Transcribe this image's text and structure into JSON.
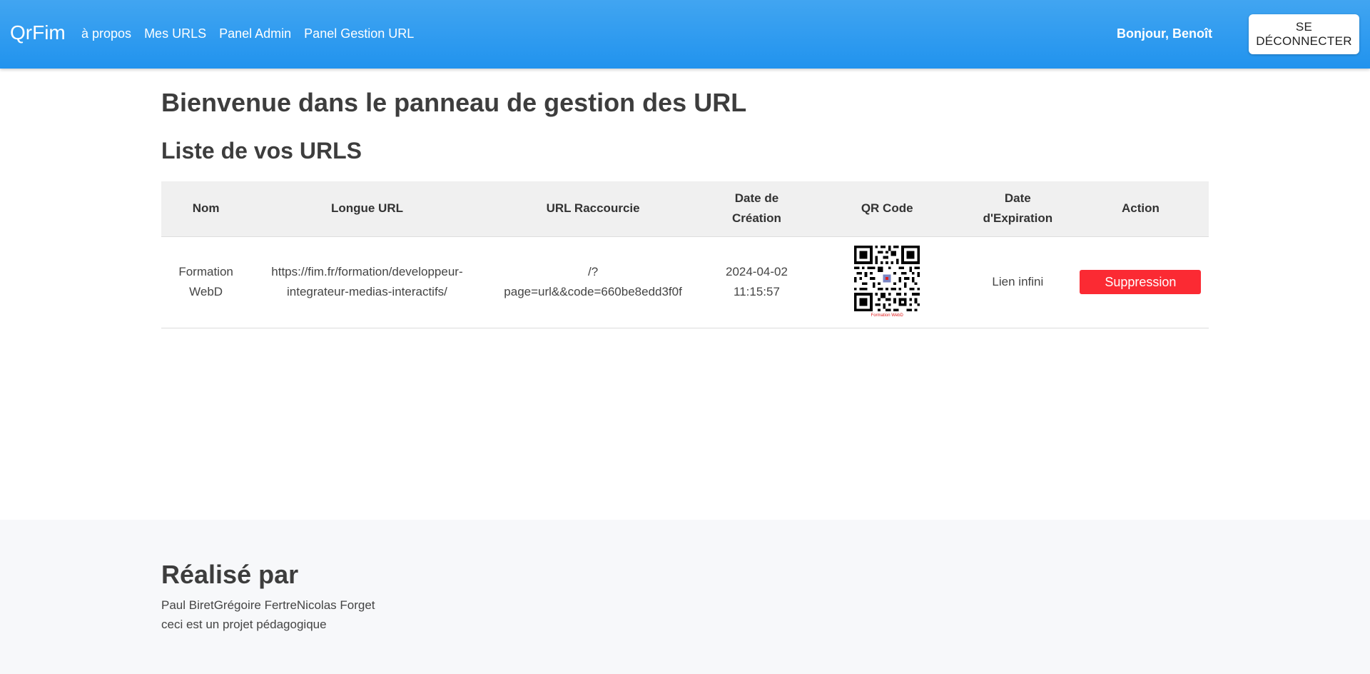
{
  "header": {
    "brand": "QrFim",
    "nav": [
      "à propos",
      "Mes URLS",
      "Panel Admin",
      "Panel Gestion URL"
    ],
    "greeting": "Bonjour, Benoît",
    "logout_label": "SE DÉCONNECTER"
  },
  "main": {
    "title": "Bienvenue dans le panneau de gestion des URL",
    "section_title": "Liste de vos URLS",
    "table": {
      "headers": {
        "nom": "Nom",
        "longue": "Longue URL",
        "raccourcie": "URL Raccourcie",
        "creation_1": "Date de",
        "creation_2": "Création",
        "qr": "QR Code",
        "expiration_1": "Date",
        "expiration_2": "d'Expiration",
        "action": "Action"
      },
      "rows": [
        {
          "nom_1": "Formation",
          "nom_2": "WebD",
          "longue_1": "https://fim.fr/formation/developpeur-",
          "longue_2": "integrateur-medias-interactifs/",
          "raccourcie_1": "/?",
          "raccourcie_2": "page=url&&code=660be8edd3f0f",
          "date_1": "2024-04-02",
          "date_2": "11:15:57",
          "qr_caption": "Formation WebD",
          "expiration": "Lien infini",
          "action_label": "Suppression"
        }
      ]
    }
  },
  "footer": {
    "title": "Réalisé par",
    "authors": "Paul BiretGrégoire FertreNicolas Forget",
    "note": "ceci est un projet pédagogique"
  },
  "colors": {
    "navbar": "#2d9af0",
    "delete": "#fb2a33",
    "footer_bg": "#f7f8fa"
  }
}
